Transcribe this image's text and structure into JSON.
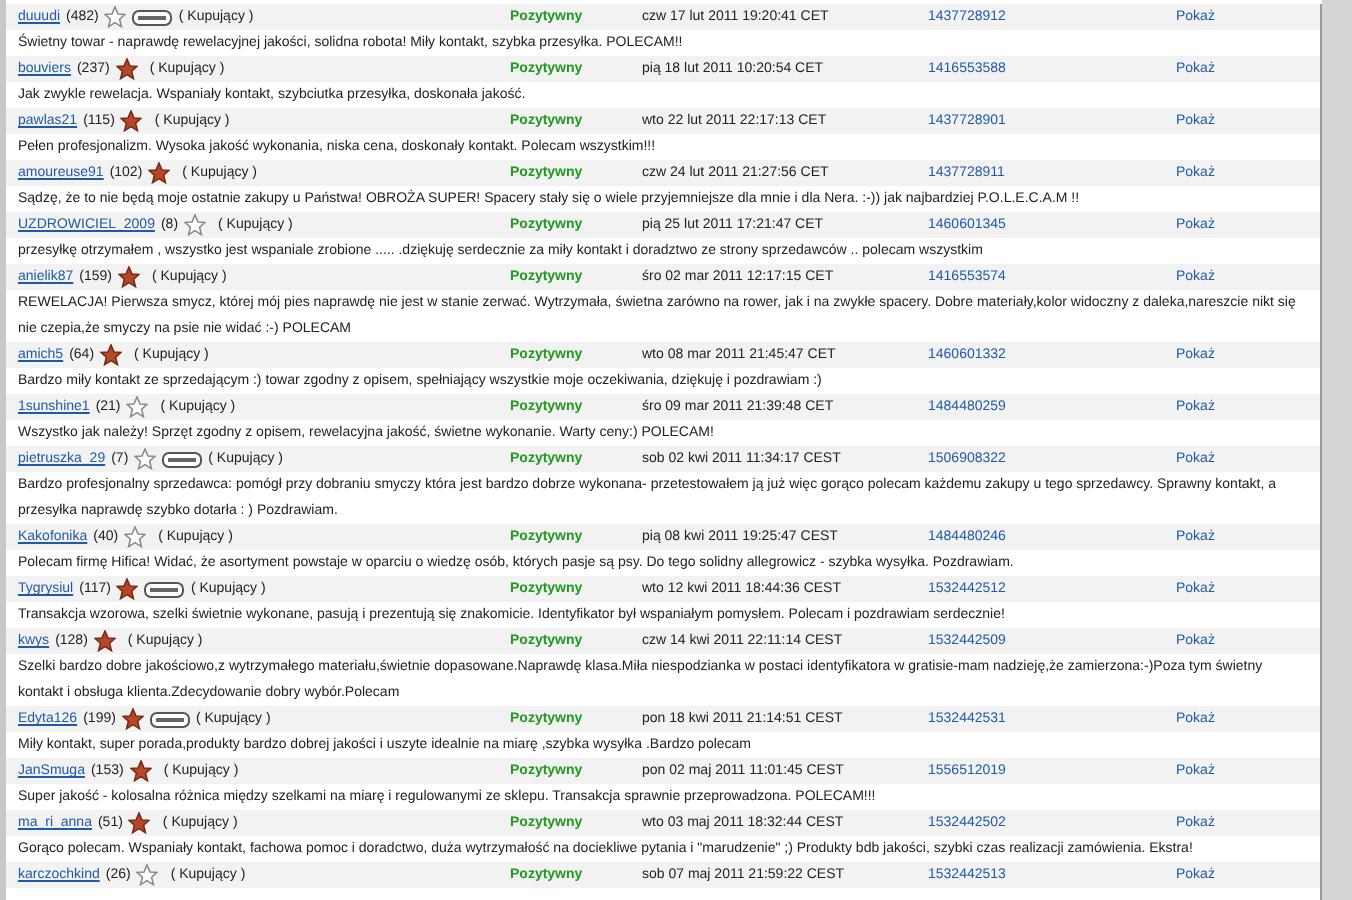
{
  "feedback": [
    {
      "user": "duuudi",
      "count": "(482)",
      "star_filled": false,
      "badge": true,
      "role": "( Kupujący )",
      "rating": "Pozytywny",
      "date": "czw 17 lut 2011 19:20:41 CET",
      "auction": "1437728912",
      "action": "Pokaż",
      "comment": "Świetny towar - naprawdę rewelacyjnej jakości, solidna robota! Miły kontakt, szybka przesyłka. POLECAM!!"
    },
    {
      "user": "bouviers",
      "count": "(237)",
      "star_filled": true,
      "badge": false,
      "role": "( Kupujący )",
      "rating": "Pozytywny",
      "date": "pią 18 lut 2011 10:20:54 CET",
      "auction": "1416553588",
      "action": "Pokaż",
      "comment": "Jak zwykle rewelacja. Wspaniały kontakt, szybciutka przesyłka, doskonała jakość."
    },
    {
      "user": "pawlas21",
      "count": "(115)",
      "star_filled": true,
      "badge": false,
      "role": "( Kupujący )",
      "rating": "Pozytywny",
      "date": "wto 22 lut 2011 22:17:13 CET",
      "auction": "1437728901",
      "action": "Pokaż",
      "comment": "Pełen profesjonalizm. Wysoka jakość wykonania, niska cena, doskonały kontakt. Polecam wszystkim!!!"
    },
    {
      "user": "amoureuse91",
      "count": "(102)",
      "star_filled": true,
      "badge": false,
      "role": "( Kupujący )",
      "rating": "Pozytywny",
      "date": "czw 24 lut 2011 21:27:56 CET",
      "auction": "1437728911",
      "action": "Pokaż",
      "comment": "Sądzę, że to nie będą moje ostatnie zakupy u Państwa! OBROŻA SUPER! Spacery stały się o wiele przyjemniejsze dla mnie i dla Nera. :-)) jak najbardziej P.O.L.E.C.A.M !!"
    },
    {
      "user": "UZDROWICIEL_2009",
      "count": "(8)",
      "star_filled": false,
      "badge": false,
      "role": "( Kupujący )",
      "rating": "Pozytywny",
      "date": "pią 25 lut 2011 17:21:47 CET",
      "auction": "1460601345",
      "action": "Pokaż",
      "comment": "przesyłkę otrzymałem , wszystko jest wspaniale zrobione ..... .dziękuję serdecznie za miły kontakt i doradztwo ze strony sprzedawców .. polecam wszystkim"
    },
    {
      "user": "anielik87",
      "count": "(159)",
      "star_filled": true,
      "badge": false,
      "role": "( Kupujący )",
      "rating": "Pozytywny",
      "date": "śro 02 mar 2011 12:17:15 CET",
      "auction": "1416553574",
      "action": "Pokaż",
      "comment": "REWELACJA! Pierwsza smycz, której mój pies naprawdę nie jest w stanie zerwać. Wytrzymała, świetna zarówno na rower, jak i na zwykłe spacery. Dobre materiały,kolor widoczny z daleka,nareszcie nikt się nie czepia,że smyczy na psie nie widać :-) POLECAM"
    },
    {
      "user": "amich5",
      "count": "(64)",
      "star_filled": true,
      "badge": false,
      "role": "( Kupujący )",
      "rating": "Pozytywny",
      "date": "wto 08 mar 2011 21:45:47 CET",
      "auction": "1460601332",
      "action": "Pokaż",
      "comment": "Bardzo miły kontakt ze sprzedającym :) towar zgodny z opisem, spełniający wszystkie moje oczekiwania, dziękuję i pozdrawiam :)"
    },
    {
      "user": "1sunshine1",
      "count": "(21)",
      "star_filled": false,
      "badge": false,
      "role": "( Kupujący )",
      "rating": "Pozytywny",
      "date": "śro 09 mar 2011 21:39:48 CET",
      "auction": "1484480259",
      "action": "Pokaż",
      "comment": "Wszystko jak należy! Sprzęt zgodny z opisem, rewelacyjna jakość, świetne wykonanie. Warty ceny:) POLECAM!"
    },
    {
      "user": "pietruszka_29",
      "count": "(7)",
      "star_filled": false,
      "badge": true,
      "role": "( Kupujący )",
      "rating": "Pozytywny",
      "date": "sob 02 kwi 2011 11:34:17 CEST",
      "auction": "1506908322",
      "action": "Pokaż",
      "comment": "Bardzo profesjonalny sprzedawca: pomógł przy dobraniu smyczy która jest bardzo dobrze wykonana- przetestowałem ją już więc gorąco polecam każdemu zakupy u tego sprzedawcy. Sprawny kontakt, a przesyłka naprawdę szybko dotarła : ) Pozdrawiam."
    },
    {
      "user": "Kakofonika",
      "count": "(40)",
      "star_filled": false,
      "badge": false,
      "role": "( Kupujący )",
      "rating": "Pozytywny",
      "date": "pią 08 kwi 2011 19:25:47 CEST",
      "auction": "1484480246",
      "action": "Pokaż",
      "comment": "Polecam firmę Hifica! Widać, że asortyment powstaje w oparciu o wiedzę osób, których pasje są psy. Do tego solidny allegrowicz - szybka wysyłka. Pozdrawiam."
    },
    {
      "user": "Tygrysiul",
      "count": "(117)",
      "star_filled": true,
      "badge": true,
      "role": "( Kupujący )",
      "rating": "Pozytywny",
      "date": "wto 12 kwi 2011 18:44:36 CEST",
      "auction": "1532442512",
      "action": "Pokaż",
      "comment": "Transakcja wzorowa, szelki świetnie wykonane, pasują i prezentują się znakomicie. Identyfikator był wspaniałym pomysłem. Polecam i pozdrawiam serdecznie!"
    },
    {
      "user": "kwys",
      "count": "(128)",
      "star_filled": true,
      "badge": false,
      "role": "( Kupujący )",
      "rating": "Pozytywny",
      "date": "czw 14 kwi 2011 22:11:14 CEST",
      "auction": "1532442509",
      "action": "Pokaż",
      "comment": "Szelki bardzo dobre jakościowo,z wytrzymałego materiału,świetnie dopasowane.Naprawdę klasa.Miła niespodzianka w postaci identyfikatora w gratisie-mam nadzieję,że zamierzona:-)Poza tym świetny kontakt i obsługa klienta.Zdecydowanie dobry wybór.Polecam"
    },
    {
      "user": "Edyta126",
      "count": "(199)",
      "star_filled": true,
      "badge": true,
      "role": "( Kupujący )",
      "rating": "Pozytywny",
      "date": "pon 18 kwi 2011 21:14:51 CEST",
      "auction": "1532442531",
      "action": "Pokaż",
      "comment": "Miły kontakt, super porada,produkty bardzo dobrej jakości i uszyte idealnie na miarę ,szybka wysyłka .Bardzo polecam"
    },
    {
      "user": "JanSmuga",
      "count": "(153)",
      "star_filled": true,
      "badge": false,
      "role": "( Kupujący )",
      "rating": "Pozytywny",
      "date": "pon 02 maj 2011 11:01:45 CEST",
      "auction": "1556512019",
      "action": "Pokaż",
      "comment": "Super jakość - kolosalna różnica między szelkami na miarę i regulowanymi ze sklepu. Transakcja sprawnie przeprowadzona. POLECAM!!!"
    },
    {
      "user": "ma_ri_anna",
      "count": "(51)",
      "star_filled": true,
      "badge": false,
      "role": "( Kupujący )",
      "rating": "Pozytywny",
      "date": "wto 03 maj 2011 18:32:44 CEST",
      "auction": "1532442502",
      "action": "Pokaż",
      "comment": "Gorąco polecam. Wspaniały kontakt, fachowa pomoc i doradctwo, duża wytrzymałość na dociekliwe pytania i \"marudzenie\" ;) Produkty bdb jakości, szybki czas realizacji zamówienia. Ekstra!"
    },
    {
      "user": "karczochkind",
      "count": "(26)",
      "star_filled": false,
      "badge": false,
      "role": "( Kupujący )",
      "rating": "Pozytywny",
      "date": "sob 07 maj 2011 21:59:22 CEST",
      "auction": "1532442513",
      "action": "Pokaż"
    }
  ]
}
